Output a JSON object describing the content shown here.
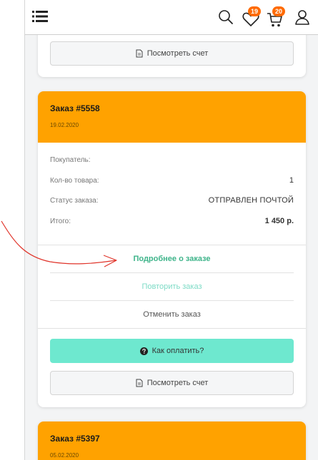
{
  "header": {
    "menu_icon": "hamburger-menu-icon",
    "search_icon": "search-icon",
    "favorites_icon": "heart-icon",
    "favorites_count": "19",
    "cart_icon": "cart-icon",
    "cart_count": "20",
    "profile_icon": "user-icon"
  },
  "top_card": {
    "view_invoice_label": "Посмотреть счет",
    "view_invoice_icon": "document-icon"
  },
  "order1": {
    "title": "Заказ #5558",
    "date": "19.02.2020",
    "rows": [
      {
        "label": "Покупатель:",
        "value": ""
      },
      {
        "label": "Кол-во товара:",
        "value": "1"
      },
      {
        "label": "Статус заказа:",
        "value": "ОТПРАВЛЕН ПОЧТОЙ"
      },
      {
        "label": "Итого:",
        "value": "1 450 р."
      }
    ],
    "details_link": "Подробнее о заказе",
    "repeat_link": "Повторить заказ",
    "cancel_link": "Отменить заказ",
    "pay_button": "Как оплатить?",
    "pay_icon": "question-circle-icon",
    "view_invoice_label": "Посмотреть счет",
    "view_invoice_icon": "document-icon"
  },
  "order2": {
    "title": "Заказ #5397",
    "date": "05.02.2020"
  },
  "colors": {
    "order_header": "#ffa200",
    "accent_green": "#6ee8cf",
    "details_link": "#3eb48a",
    "repeat_link": "#7ddbc6",
    "badge": "#ff6a00",
    "annotation_arrow": "#e0342a"
  }
}
